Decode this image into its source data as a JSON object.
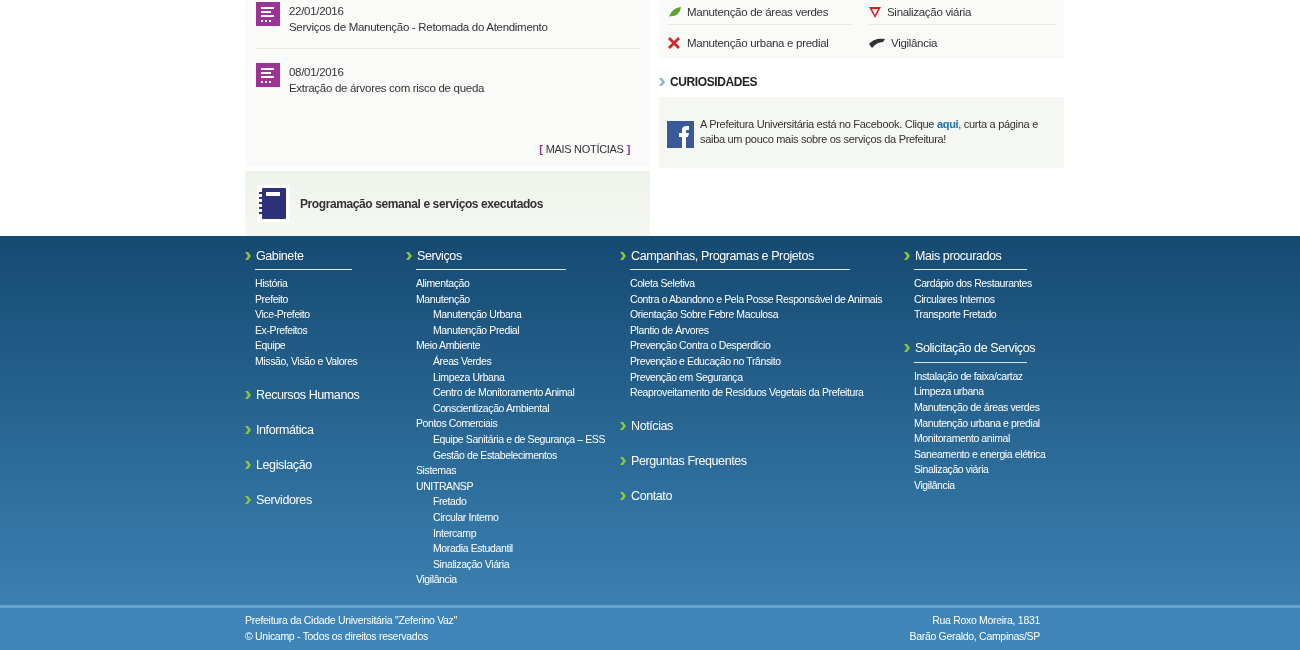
{
  "news": {
    "items": [
      {
        "date": "22/01/2016",
        "title": "Serviços de Manutenção - Retomada do Atendimento"
      },
      {
        "date": "08/01/2016",
        "title": "Extração de árvores com risco de queda"
      }
    ],
    "more_link": {
      "open": "[",
      "label": "MAIS NOTÍCIAS",
      "close": "]"
    }
  },
  "schedule_box": {
    "label": "Programação semanal e serviços executados"
  },
  "services": [
    {
      "kind": "leaf",
      "label": "Manutenção de áreas verdes"
    },
    {
      "kind": "sign",
      "label": "Sinalização viária"
    },
    {
      "kind": "tools",
      "label": "Manutenção urbana e predial"
    },
    {
      "kind": "cap",
      "label": "Vigilância"
    }
  ],
  "curiosidades": {
    "title": "CURIOSIDADES",
    "before": "A Prefeitura Universitária está no Facebook. Clique ",
    "link": "aqui",
    "after": ", curta a página e saiba um pouco mais sobre os serviços da Prefeitura!"
  },
  "footer": {
    "columns": [
      {
        "groups": [
          {
            "title": "Gabinete",
            "links": [
              {
                "label": "História"
              },
              {
                "label": "Prefeito"
              },
              {
                "label": "Vice-Prefeito"
              },
              {
                "label": "Ex-Prefeitos"
              },
              {
                "label": "Equipe"
              },
              {
                "label": "Missão, Visão e Valores"
              }
            ]
          },
          {
            "title": "Recursos Humanos"
          },
          {
            "title": "Informática"
          },
          {
            "title": "Legislação"
          },
          {
            "title": "Servidores"
          }
        ]
      },
      {
        "groups": [
          {
            "title": "Serviços",
            "links": [
              {
                "label": "Alimentação"
              },
              {
                "label": "Manutenção",
                "children": [
                  {
                    "label": "Manutenção Urbana"
                  },
                  {
                    "label": "Manutenção Predial"
                  }
                ]
              },
              {
                "label": "Meio Ambiente",
                "children": [
                  {
                    "label": "Áreas Verdes"
                  },
                  {
                    "label": "Limpeza Urbana"
                  },
                  {
                    "label": "Centro de Monitoramento Animal"
                  },
                  {
                    "label": "Conscientização Ambiental"
                  }
                ]
              },
              {
                "label": "Pontos Comerciais",
                "children": [
                  {
                    "label": "Equipe Sanitária e de Segurança – ESS"
                  },
                  {
                    "label": "Gestão de Estabelecimentos"
                  }
                ]
              },
              {
                "label": "Sistemas"
              },
              {
                "label": "UNITRANSP",
                "children": [
                  {
                    "label": "Fretado"
                  },
                  {
                    "label": "Circular Interno"
                  },
                  {
                    "label": "Intercamp"
                  },
                  {
                    "label": "Moradia Estudantil"
                  },
                  {
                    "label": "Sinalização Viária"
                  }
                ]
              },
              {
                "label": "Vigilância"
              }
            ]
          }
        ]
      },
      {
        "groups": [
          {
            "title": "Campanhas, Programas e Projetos",
            "links": [
              {
                "label": "Coleta Seletiva"
              },
              {
                "label": "Contra o Abandono e Pela Posse Responsável de Animais"
              },
              {
                "label": "Orientação Sobre Febre Maculosa"
              },
              {
                "label": "Plantio de Árvores"
              },
              {
                "label": "Prevenção Contra o Desperdício"
              },
              {
                "label": "Prevenção e Educação no Trânsito"
              },
              {
                "label": "Prevenção em Segurança"
              },
              {
                "label": "Reaproveitamento de Resíduos Vegetais da Prefeitura"
              }
            ]
          },
          {
            "title": "Notícias"
          },
          {
            "title": "Perguntas Frequentes"
          },
          {
            "title": "Contato"
          }
        ]
      },
      {
        "groups": [
          {
            "title": "Mais procurados",
            "links": [
              {
                "label": "Cardápio dos Restaurantes"
              },
              {
                "label": "Circulares Internos"
              },
              {
                "label": "Transporte Fretado"
              }
            ]
          },
          {
            "title": "Solicitação de Serviços",
            "links": [
              {
                "label": "Instalação de faixa/cartaz"
              },
              {
                "label": "Limpeza urbana"
              },
              {
                "label": "Manutenção de áreas verdes"
              },
              {
                "label": "Manutenção urbana e predial"
              },
              {
                "label": "Monitoramento animal"
              },
              {
                "label": "Saneamento e energia elétrica"
              },
              {
                "label": "Sinalização viária"
              },
              {
                "label": "Vigilância"
              }
            ]
          }
        ]
      }
    ]
  },
  "bottom_bar": {
    "left": [
      "Prefeitura da Cidade Universitária \"Zeferino Vaz\"",
      "© Unicamp - Todos os direitos reservados"
    ],
    "right": [
      "Rua Roxo Moreira, 1831",
      "Barão Geraldo, Campinas/SP"
    ]
  }
}
